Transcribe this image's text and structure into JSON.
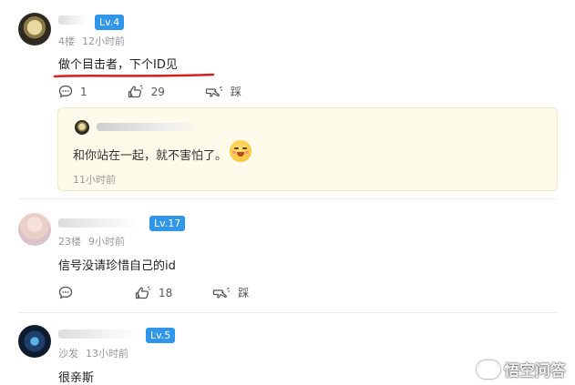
{
  "comments": [
    {
      "user": {
        "name": "",
        "level": "Lv.4"
      },
      "floor": "4楼",
      "time": "12小时前",
      "text": "做个目击者，下个ID见",
      "actions": {
        "reply_count": "1",
        "like_count": "29",
        "dislike_label": "踩"
      },
      "reply": {
        "user": {
          "name": ""
        },
        "text": "和你站在一起，就不害怕了。",
        "time": "11小时前"
      }
    },
    {
      "user": {
        "name": "",
        "level": "Lv.17"
      },
      "floor": "23楼",
      "time": "9小时前",
      "text": "信号没请珍惜自己的id",
      "actions": {
        "like_count": "18",
        "dislike_label": "踩"
      }
    },
    {
      "user": {
        "name": "",
        "level": "Lv.5"
      },
      "floor": "沙发",
      "time": "13小时前",
      "text": "很亲斯"
    }
  ],
  "watermark": {
    "text": "悟空问答"
  },
  "colors": {
    "badge": "#2f96ea",
    "underline": "#d61f1f",
    "reply_bg": "#fffbea"
  },
  "icons": [
    "comment-icon",
    "like-icon",
    "dislike-icon",
    "emoji-smile-icon",
    "wukong-logo-icon"
  ]
}
